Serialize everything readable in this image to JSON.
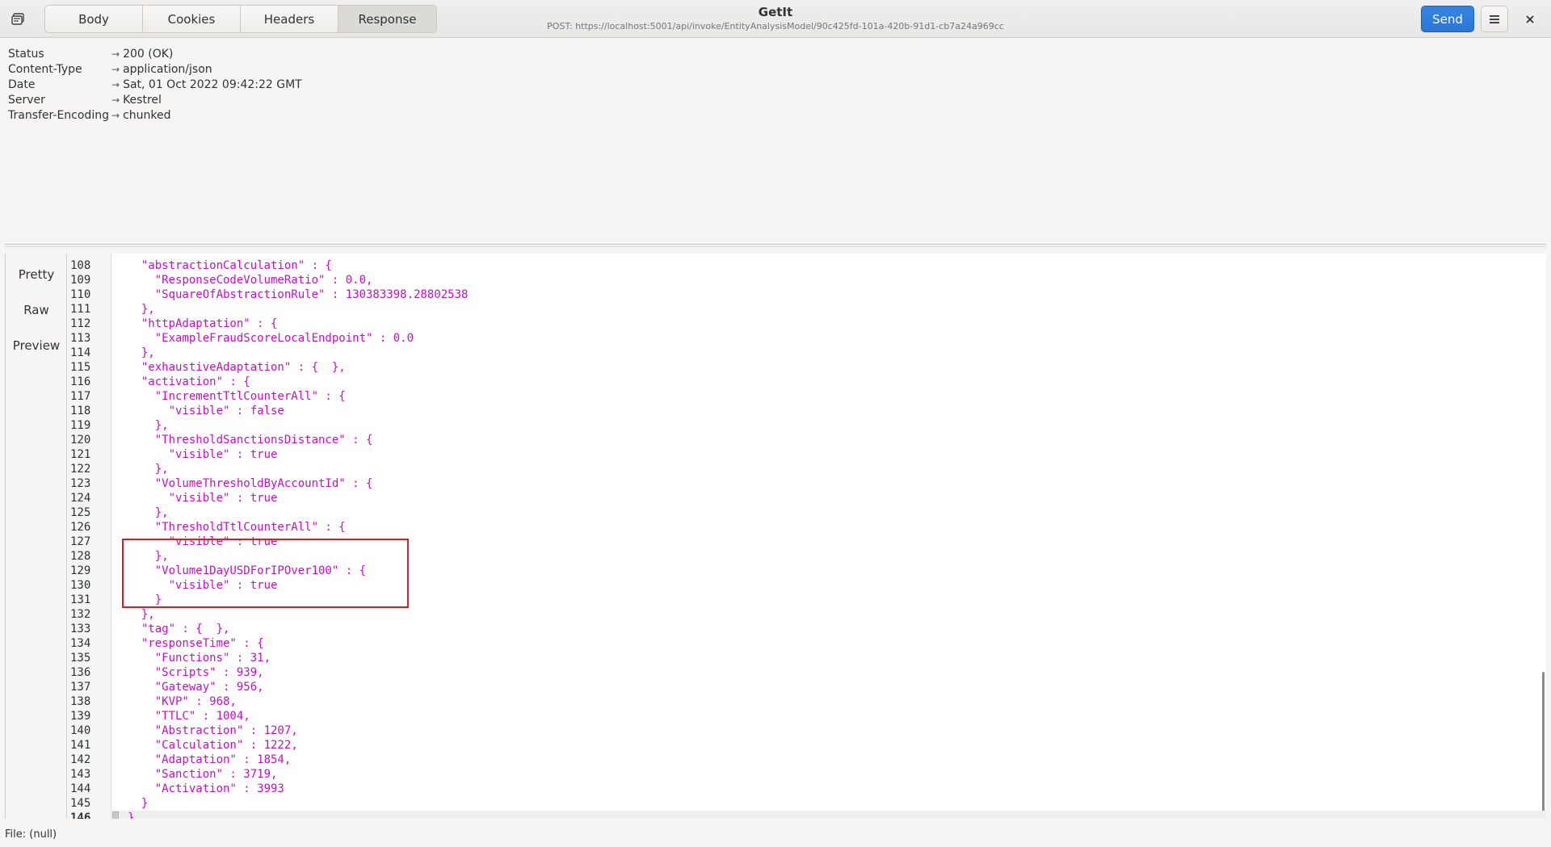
{
  "header": {
    "tabs": [
      {
        "label": "Body"
      },
      {
        "label": "Cookies"
      },
      {
        "label": "Headers"
      },
      {
        "label": "Response"
      }
    ],
    "active_tab": "Response",
    "title": "GetIt",
    "subtitle": "POST: https://localhost:5001/api/invoke/EntityAnalysisModel/90c425fd-101a-420b-91d1-cb7a24a969cc",
    "send_label": "Send",
    "accent_color": "#3584e4"
  },
  "response_headers": [
    {
      "key": "Status",
      "value": "200 (OK)"
    },
    {
      "key": "Content-Type",
      "value": "application/json"
    },
    {
      "key": "Date",
      "value": "Sat, 01 Oct 2022 09:42:22 GMT"
    },
    {
      "key": "Server",
      "value": "Kestrel"
    },
    {
      "key": "Transfer-Encoding",
      "value": "chunked"
    }
  ],
  "side_panel": {
    "items": [
      {
        "label": "Pretty"
      },
      {
        "label": "Raw"
      },
      {
        "label": "Preview"
      }
    ],
    "active": "Pretty"
  },
  "code": {
    "current_line": "146",
    "lines": [
      {
        "n": "108",
        "t": "  \"abstractionCalculation\" : {"
      },
      {
        "n": "109",
        "t": "    \"ResponseCodeVolumeRatio\" : 0.0,"
      },
      {
        "n": "110",
        "t": "    \"SquareOfAbstractionRule\" : 130383398.28802538"
      },
      {
        "n": "111",
        "t": "  },"
      },
      {
        "n": "112",
        "t": "  \"httpAdaptation\" : {"
      },
      {
        "n": "113",
        "t": "    \"ExampleFraudScoreLocalEndpoint\" : 0.0"
      },
      {
        "n": "114",
        "t": "  },"
      },
      {
        "n": "115",
        "t": "  \"exhaustiveAdaptation\" : {  },"
      },
      {
        "n": "116",
        "t": "  \"activation\" : {"
      },
      {
        "n": "117",
        "t": "    \"IncrementTtlCounterAll\" : {"
      },
      {
        "n": "118",
        "t": "      \"visible\" : false"
      },
      {
        "n": "119",
        "t": "    },"
      },
      {
        "n": "120",
        "t": "    \"ThresholdSanctionsDistance\" : {"
      },
      {
        "n": "121",
        "t": "      \"visible\" : true"
      },
      {
        "n": "122",
        "t": "    },"
      },
      {
        "n": "123",
        "t": "    \"VolumeThresholdByAccountId\" : {"
      },
      {
        "n": "124",
        "t": "      \"visible\" : true"
      },
      {
        "n": "125",
        "t": "    },"
      },
      {
        "n": "126",
        "t": "    \"ThresholdTtlCounterAll\" : {"
      },
      {
        "n": "127",
        "t": "      \"visible\" : true"
      },
      {
        "n": "128",
        "t": "    },"
      },
      {
        "n": "129",
        "t": "    \"Volume1DayUSDForIPOver100\" : {"
      },
      {
        "n": "130",
        "t": "      \"visible\" : true"
      },
      {
        "n": "131",
        "t": "    }"
      },
      {
        "n": "132",
        "t": "  },"
      },
      {
        "n": "133",
        "t": "  \"tag\" : {  },"
      },
      {
        "n": "134",
        "t": "  \"responseTime\" : {"
      },
      {
        "n": "135",
        "t": "    \"Functions\" : 31,"
      },
      {
        "n": "136",
        "t": "    \"Scripts\" : 939,"
      },
      {
        "n": "137",
        "t": "    \"Gateway\" : 956,"
      },
      {
        "n": "138",
        "t": "    \"KVP\" : 968,"
      },
      {
        "n": "139",
        "t": "    \"TTLC\" : 1004,"
      },
      {
        "n": "140",
        "t": "    \"Abstraction\" : 1207,"
      },
      {
        "n": "141",
        "t": "    \"Calculation\" : 1222,"
      },
      {
        "n": "142",
        "t": "    \"Adaptation\" : 1854,"
      },
      {
        "n": "143",
        "t": "    \"Sanction\" : 3719,"
      },
      {
        "n": "144",
        "t": "    \"Activation\" : 3993"
      },
      {
        "n": "145",
        "t": "  }"
      },
      {
        "n": "146",
        "t": "}"
      }
    ],
    "text_color": "#c40fc4"
  },
  "highlight_color": "#e01b24",
  "status_bar": "File: (null)"
}
